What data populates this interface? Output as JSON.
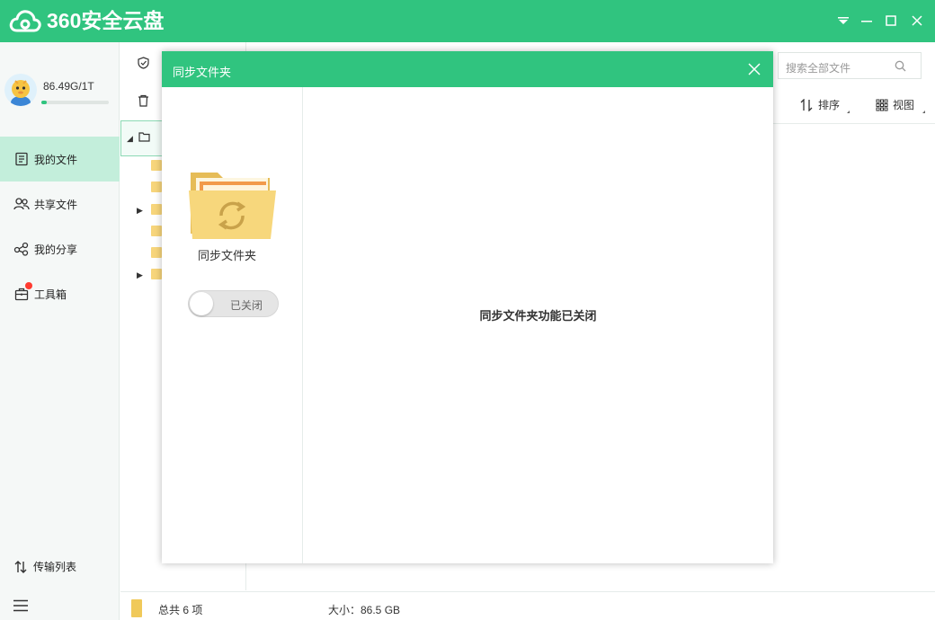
{
  "app": {
    "title": "360安全云盘",
    "brand_color": "#30c47f"
  },
  "user": {
    "quota_text": "86.49G/1T",
    "quota_used_fraction": 0.0845
  },
  "sidebar": {
    "items": [
      {
        "label": "我的文件",
        "icon": "my-files-icon",
        "active": true
      },
      {
        "label": "共享文件",
        "icon": "shared-files-icon",
        "active": false
      },
      {
        "label": "我的分享",
        "icon": "share-icon",
        "active": false
      },
      {
        "label": "工具箱",
        "icon": "toolbox-icon",
        "active": false,
        "badge": "red-dot"
      }
    ],
    "transfer_label": "传输列表"
  },
  "toolbar": {
    "search_placeholder": "搜索全部文件",
    "sort_label": "排序",
    "view_label": "视图"
  },
  "status": {
    "total": "总共 6 项",
    "size": "大小：86.5 GB"
  },
  "dialog": {
    "title": "同步文件夹",
    "folder_label": "同步文件夹",
    "toggle_label": "已关闭",
    "toggle_on": false,
    "message": "同步文件夹功能已关闭"
  }
}
